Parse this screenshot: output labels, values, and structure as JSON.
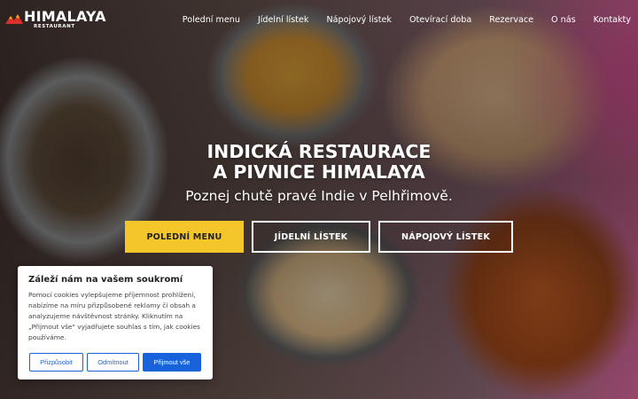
{
  "brand": {
    "name": "HIMALAYA",
    "tagline": "RESTAURANT"
  },
  "nav": {
    "items": [
      {
        "label": "Polední menu"
      },
      {
        "label": "Jídelní lístek"
      },
      {
        "label": "Nápojový lístek"
      },
      {
        "label": "Otevírací doba"
      },
      {
        "label": "Rezervace"
      },
      {
        "label": "O nás"
      },
      {
        "label": "Kontakty"
      }
    ]
  },
  "hero": {
    "title_line1": "INDICKÁ RESTAURACE",
    "title_line2": "A PIVNICE HIMALAYA",
    "subtitle": "Poznej chutě pravé Indie v Pelhřimově.",
    "buttons": {
      "lunch": "POLEDNÍ MENU",
      "menu": "JÍDELNÍ LÍSTEK",
      "drinks": "NÁPOJOVÝ LÍSTEK"
    }
  },
  "cookie": {
    "title": "Záleží nám na vašem soukromí",
    "text": "Pomocí cookies vylepšujeme příjemnost prohlížení, nabízíme na míru přizpůsobené reklamy či obsah a analyzujeme návštěvnost stránky. Kliknutím na „Přijmout vše\" vyjadřujete souhlas s tím, jak cookies používáme.",
    "customize": "Přizpůsobit",
    "reject": "Odmítnout",
    "accept": "Přijmout vše"
  },
  "colors": {
    "accent_yellow": "#f5c62a",
    "cookie_blue": "#1863dc",
    "logo_red": "#d8312a",
    "logo_orange": "#f39a1f"
  }
}
